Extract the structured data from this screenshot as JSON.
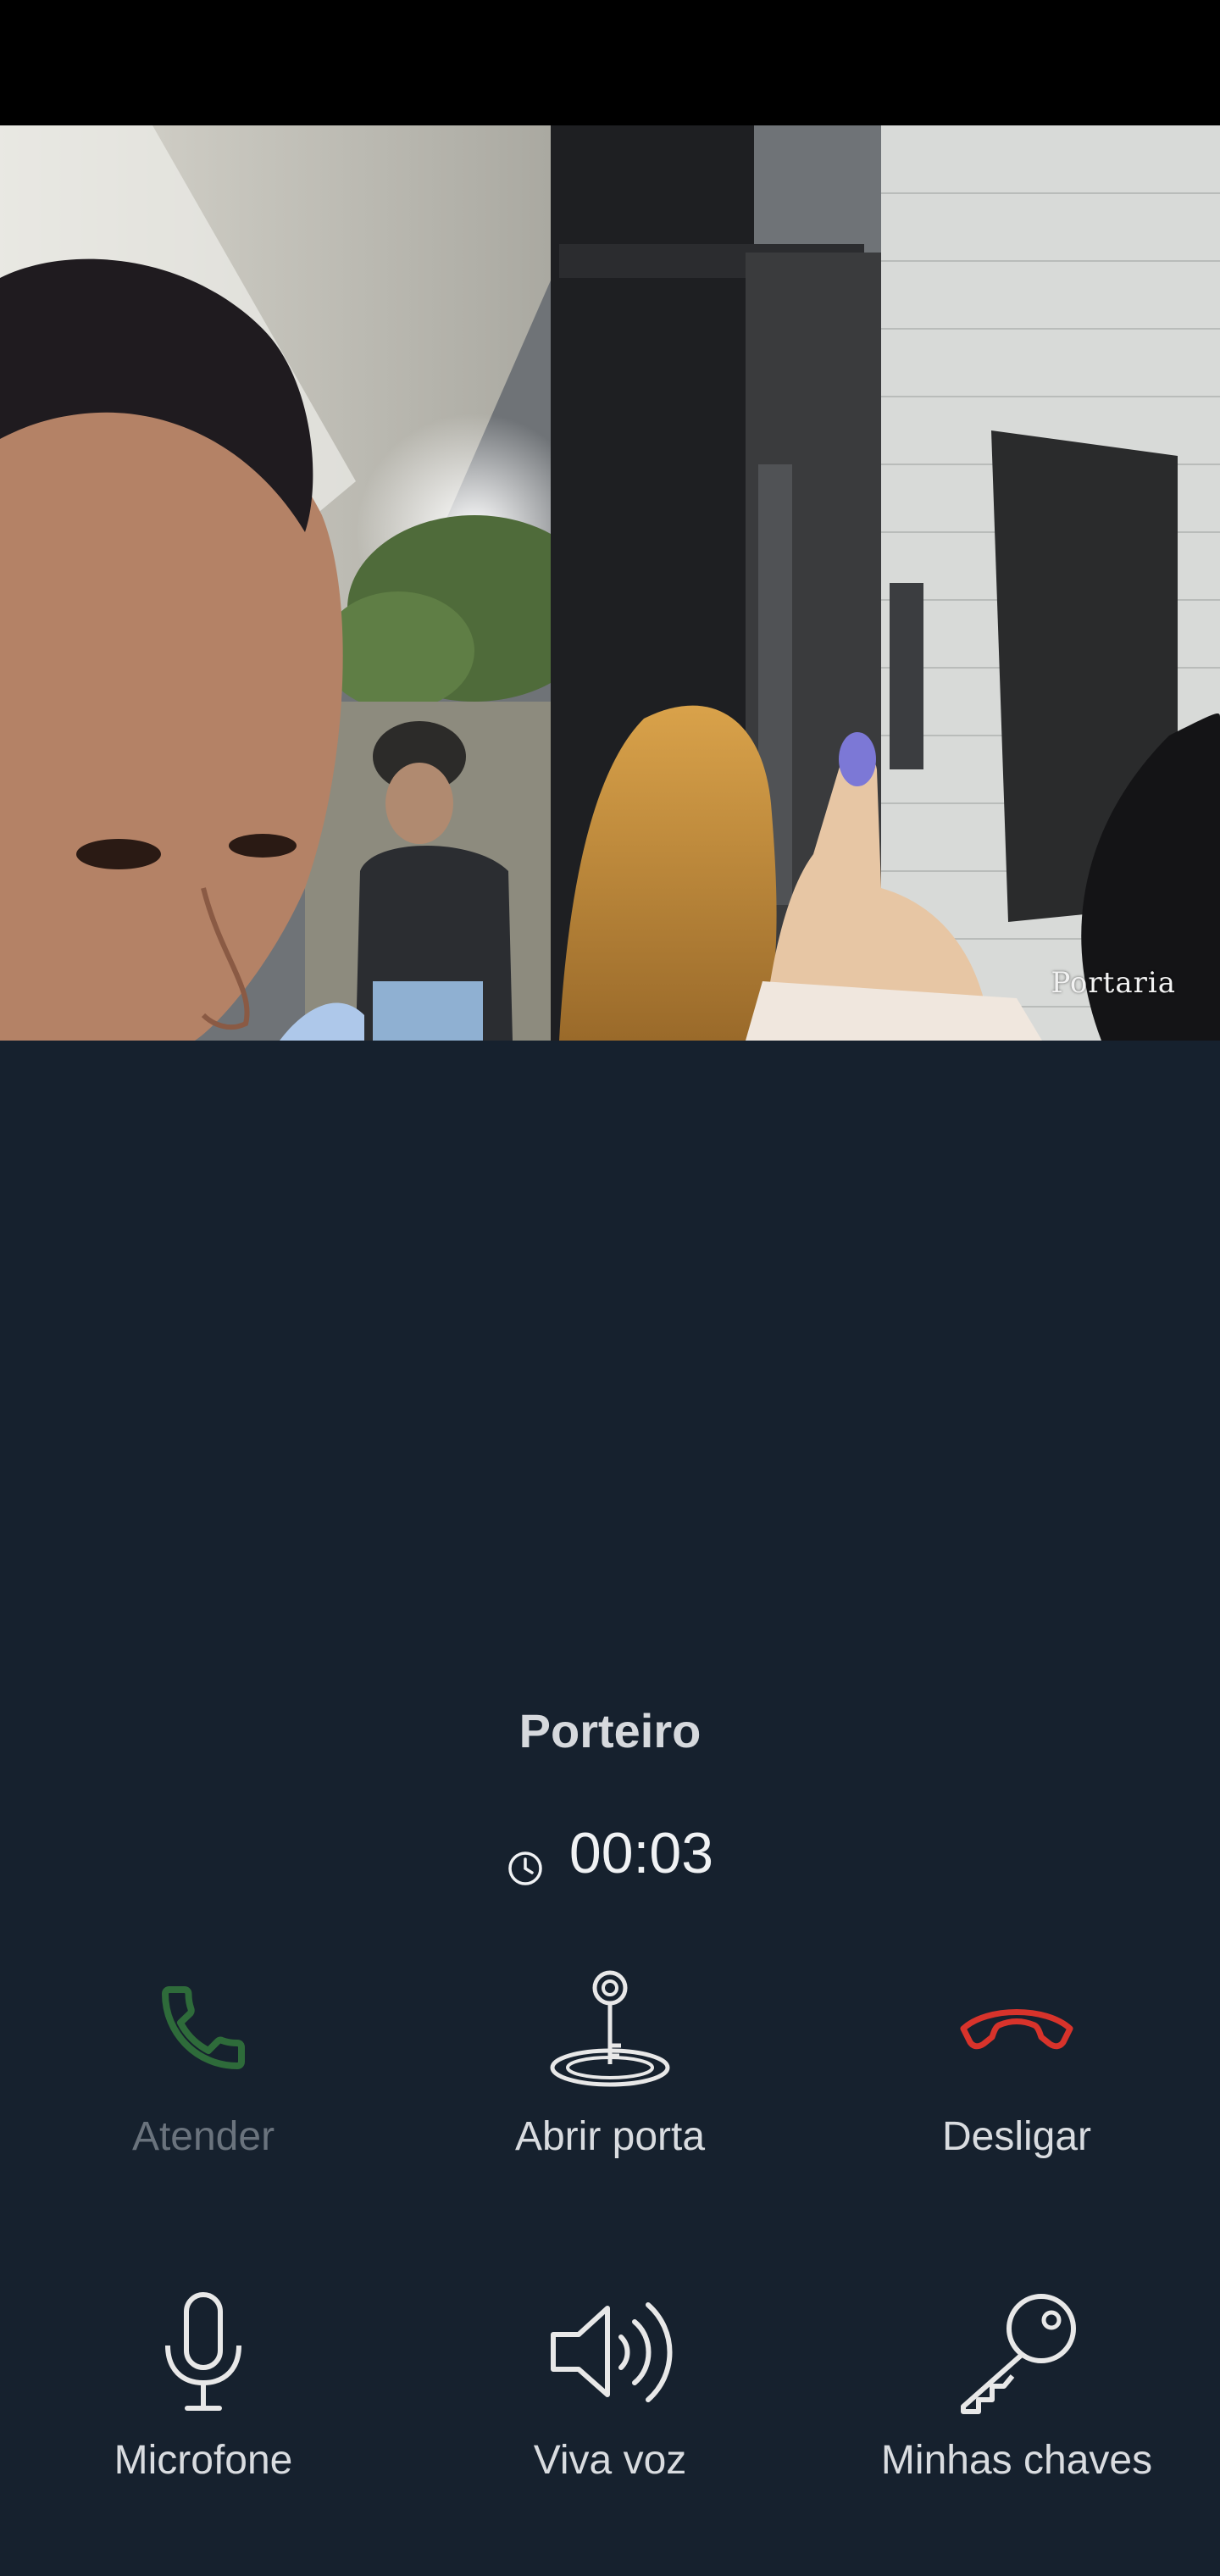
{
  "video": {
    "camera_label": "Portaria"
  },
  "call": {
    "caller_name": "Porteiro",
    "elapsed": "00:03"
  },
  "actions_row1": [
    {
      "label": "Atender",
      "icon": "phone-icon",
      "color": "#2e6b3a",
      "enabled": false
    },
    {
      "label": "Abrir porta",
      "icon": "door-key-icon",
      "color": "#e8e8e8",
      "enabled": true
    },
    {
      "label": "Desligar",
      "icon": "hang-up-icon",
      "color": "#d8332b",
      "enabled": true
    }
  ],
  "actions_row2": [
    {
      "label": "Microfone",
      "icon": "microphone-icon",
      "color": "#e8e8e8",
      "enabled": true
    },
    {
      "label": "Viva voz",
      "icon": "speaker-icon",
      "color": "#e8e8e8",
      "enabled": true
    },
    {
      "label": "Minhas chaves",
      "icon": "key-icon",
      "color": "#e8e8e8",
      "enabled": true
    }
  ],
  "theme": {
    "background": "#16212e",
    "status_bar": "#000000"
  }
}
